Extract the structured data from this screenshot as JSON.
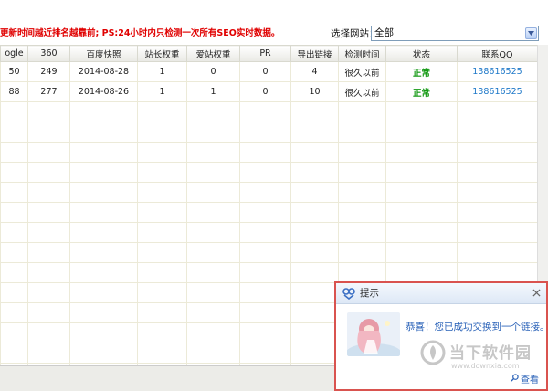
{
  "notice": "更新时间越近排名越靠前; PS:24小时内只检测一次所有SEO实时数据。",
  "site_select": {
    "label": "选择网站：",
    "value": "全部"
  },
  "table": {
    "columns": [
      "ogle",
      "360",
      "百度快照",
      "站长权重",
      "爱站权重",
      "PR",
      "导出链接",
      "检测时间",
      "状态",
      "联系QQ"
    ],
    "rows": [
      [
        "50",
        "249",
        "2014-08-28",
        "1",
        "0",
        "0",
        "4",
        "很久以前",
        "正常",
        "138616525"
      ],
      [
        "88",
        "277",
        "2014-08-26",
        "1",
        "1",
        "0",
        "10",
        "很久以前",
        "正常",
        "138616525"
      ]
    ]
  },
  "popup": {
    "title": "提示",
    "message": "恭喜！您已成功交换到一个链接。",
    "view_label": "查看",
    "watermark": {
      "name": "当下软件园",
      "url": "www.downxia.com"
    }
  },
  "colors": {
    "notice_red": "#e00000",
    "status_green": "#159a15",
    "link_blue": "#1e78c8",
    "popup_border": "#d9534f"
  },
  "icons": [
    "chevron-down-icon",
    "link-icon",
    "close-icon",
    "search-icon"
  ]
}
